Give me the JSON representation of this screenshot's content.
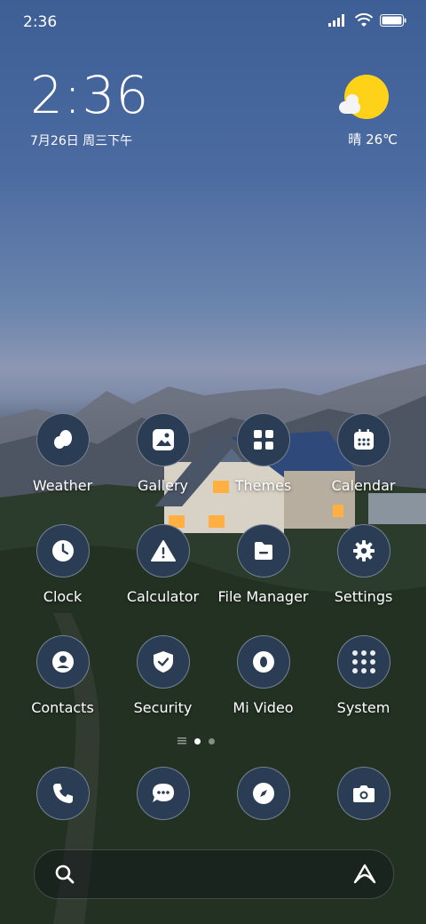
{
  "status_bar": {
    "time": "2:36"
  },
  "clock_widget": {
    "time": "2:36",
    "date": "7月26日 周三下午"
  },
  "weather_widget": {
    "condition_temp": "晴 26℃"
  },
  "apps": [
    {
      "label": "Weather",
      "icon": "weather-icon"
    },
    {
      "label": "Gallery",
      "icon": "gallery-icon"
    },
    {
      "label": "Themes",
      "icon": "themes-icon"
    },
    {
      "label": "Calendar",
      "icon": "calendar-icon"
    },
    {
      "label": "Clock",
      "icon": "clock-icon"
    },
    {
      "label": "Calculator",
      "icon": "calculator-icon"
    },
    {
      "label": "File Manager",
      "icon": "file-manager-icon"
    },
    {
      "label": "Settings",
      "icon": "gear-icon"
    },
    {
      "label": "Contacts",
      "icon": "contacts-icon"
    },
    {
      "label": "Security",
      "icon": "shield-icon"
    },
    {
      "label": "Mi Video",
      "icon": "video-icon"
    },
    {
      "label": "System",
      "icon": "folder-icon"
    }
  ],
  "dock": [
    {
      "icon": "phone-icon"
    },
    {
      "icon": "messages-icon"
    },
    {
      "icon": "browser-compass-icon"
    },
    {
      "icon": "camera-icon"
    }
  ],
  "page_indicator": {
    "pages": 2,
    "current": 1
  },
  "colors": {
    "icon_bg": "#2a3d55",
    "sun": "#ffd21a"
  }
}
